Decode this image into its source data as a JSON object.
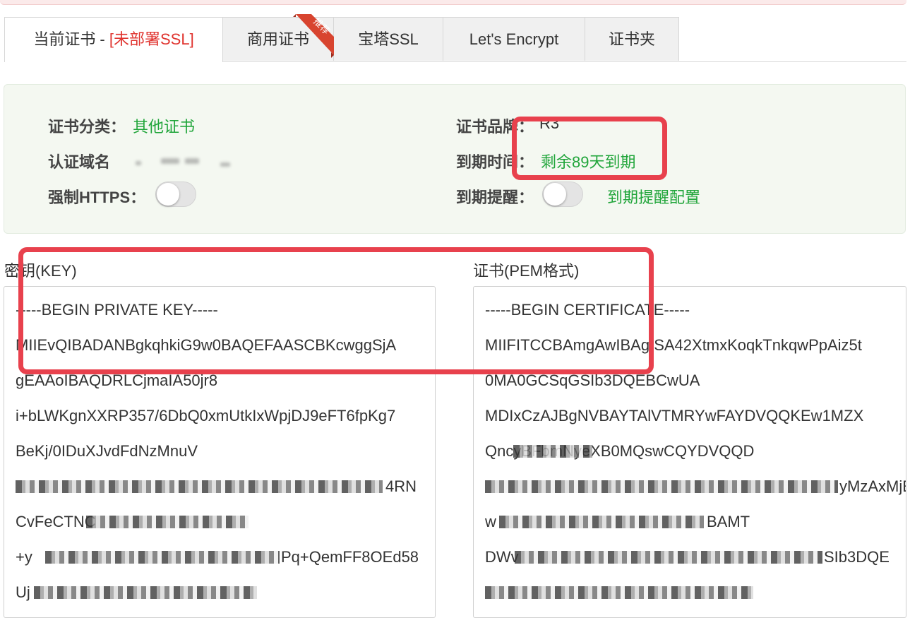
{
  "tabs": [
    {
      "label": "当前证书 - ",
      "badge": "[未部署SSL]",
      "active": true
    },
    {
      "label": "商用证书",
      "ribbon": "推荐"
    },
    {
      "label": "宝塔SSL"
    },
    {
      "label": "Let's Encrypt"
    },
    {
      "label": "证书夹"
    }
  ],
  "info": {
    "category_label": "证书分类：",
    "category_value": "其他证书",
    "domain_label": "认证域名",
    "https_label": "强制HTTPS：",
    "brand_label": "证书品牌：",
    "brand_value": "R3",
    "expire_label": "到期时间：",
    "expire_value": "剩余89天到期",
    "remind_label": "到期提醒：",
    "remind_config": "到期提醒配置"
  },
  "key": {
    "title": "密钥(KEY)",
    "lines": [
      "-----BEGIN PRIVATE KEY-----",
      "MIIEvQIBADANBgkqhkiG9w0BAQEFAASCBKcwggSjA",
      "gEAAoIBAQDRLCjmaIA50jr8",
      "i+bLWKgnXXRP357/6DbQ0xmUtkIxWpjDJ9eFT6fpKg7",
      "BeKj/0IDuXJvdFdNzMnuV",
      "4RN",
      "CvFeCTNC",
      "+y",
      "Pq+QemFF8OEd58",
      "Uj"
    ]
  },
  "cert": {
    "title": "证书(PEM格式)",
    "lines": [
      "-----BEGIN CERTIFICATE-----",
      "MIIFITCCBAmgAwIBAgISA42XtmxKoqkTnkqwPpAiz5t",
      "0MA0GCSqGSIb3DQEBCwUA",
      "MDIxCzAJBgNVBAYTAlVTMRYwFAYDVQQKEw1MZX",
      "QncyBFbmNyeXB0MQswCQYDVQQD",
      "yMzAxMjE",
      "w",
      "BAMT",
      "DWv",
      "SIb3DQE"
    ]
  }
}
